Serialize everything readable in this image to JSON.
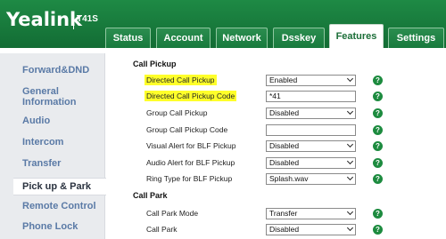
{
  "brand": {
    "logo": "Yealink",
    "model": "T41S"
  },
  "tabs": [
    {
      "label": "Status",
      "active": false
    },
    {
      "label": "Account",
      "active": false
    },
    {
      "label": "Network",
      "active": false
    },
    {
      "label": "Dsskey",
      "active": false
    },
    {
      "label": "Features",
      "active": true
    },
    {
      "label": "Settings",
      "active": false
    }
  ],
  "sidebar": {
    "items": [
      {
        "label": "Forward&DND",
        "active": false
      },
      {
        "label": "General Information",
        "active": false
      },
      {
        "label": "Audio",
        "active": false
      },
      {
        "label": "Intercom",
        "active": false
      },
      {
        "label": "Transfer",
        "active": false
      },
      {
        "label": "Pick up & Park",
        "active": true
      },
      {
        "label": "Remote Control",
        "active": false
      },
      {
        "label": "Phone Lock",
        "active": false
      }
    ]
  },
  "sections": {
    "call_pickup": "Call Pickup",
    "call_park": "Call Park"
  },
  "rows": [
    {
      "label": "Directed Call Pickup",
      "type": "select",
      "value": "Enabled",
      "highlighted": true
    },
    {
      "label": "Directed Call Pickup Code",
      "type": "input",
      "value": "*41",
      "highlighted": true
    },
    {
      "label": "Group Call Pickup",
      "type": "select",
      "value": "Disabled",
      "highlighted": false
    },
    {
      "label": "Group Call Pickup Code",
      "type": "input",
      "value": "",
      "highlighted": false
    },
    {
      "label": "Visual Alert for BLF Pickup",
      "type": "select",
      "value": "Disabled",
      "highlighted": false
    },
    {
      "label": "Audio Alert for BLF Pickup",
      "type": "select",
      "value": "Disabled",
      "highlighted": false
    },
    {
      "label": "Ring Type for BLF Pickup",
      "type": "select",
      "value": "Splash.wav",
      "highlighted": false
    },
    {
      "label": "Call Park Mode",
      "type": "select",
      "value": "Transfer",
      "highlighted": false
    },
    {
      "label": "Call Park",
      "type": "select",
      "value": "Disabled",
      "highlighted": false
    }
  ],
  "help_glyph": "?",
  "colors": {
    "header_green": "#1e8a45",
    "highlight": "#ffff2a",
    "help_green": "#1d8b3f",
    "sidebar_link": "#5a7aa6"
  },
  "icons": {
    "help": "help-icon",
    "dropdown": "chevron-down-icon"
  }
}
